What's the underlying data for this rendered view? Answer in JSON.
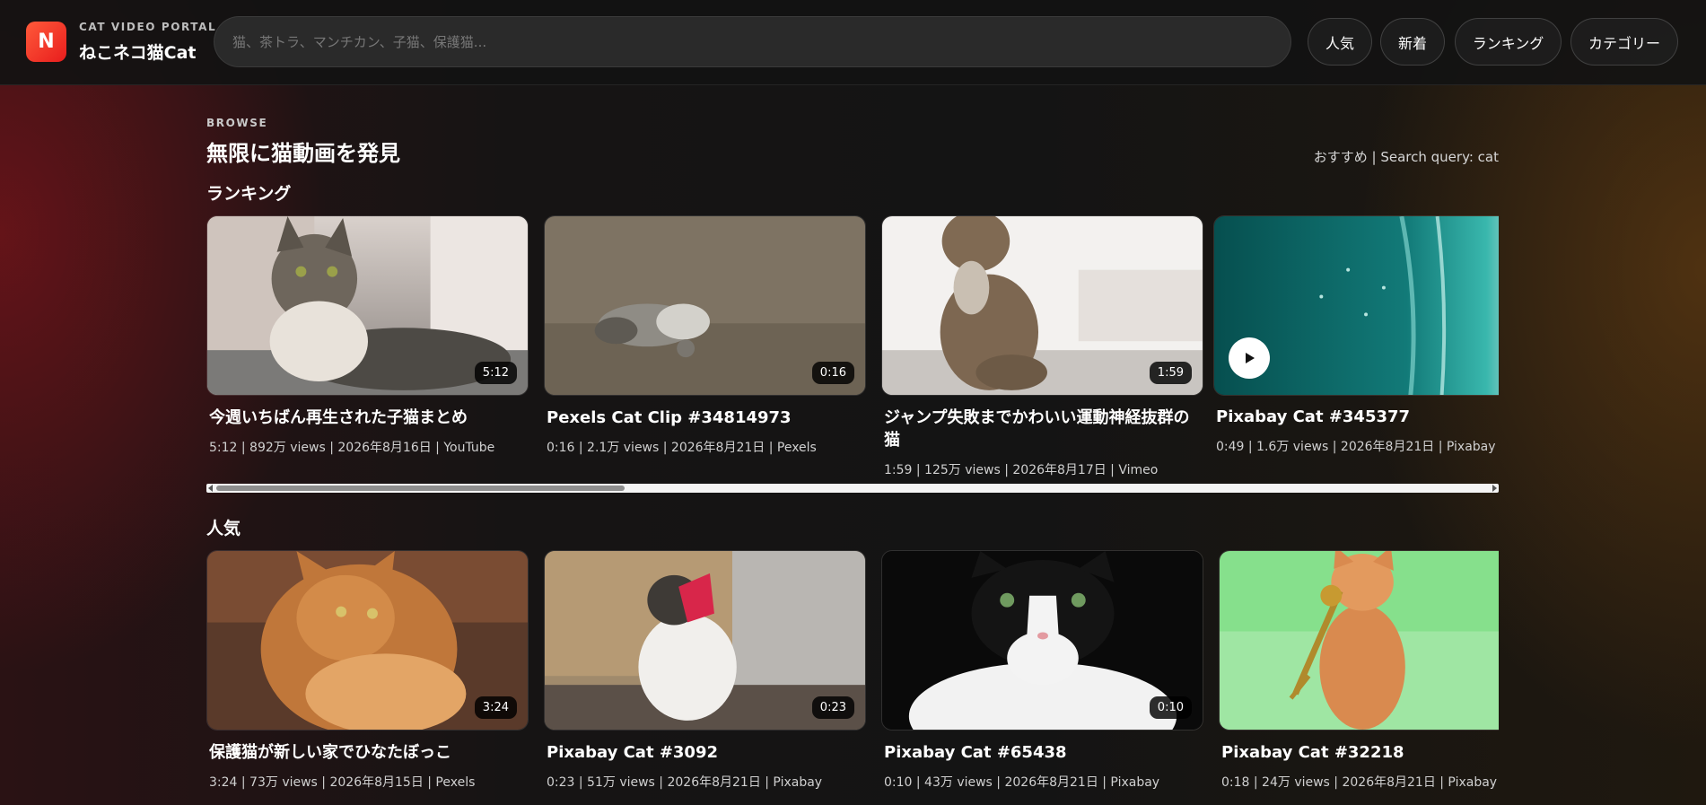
{
  "brand": {
    "badge": "N",
    "subtitle": "CAT VIDEO PORTAL",
    "title": "ねこネコ猫Cat"
  },
  "search": {
    "placeholder": "猫、茶トラ、マンチカン、子猫、保護猫..."
  },
  "nav": [
    "人気",
    "新着",
    "ランキング",
    "カテゴリー"
  ],
  "page": {
    "eyebrow": "BROWSE",
    "title": "無限に猫動画を発見",
    "meta": "おすすめ | Search query: cat"
  },
  "sections": [
    {
      "title": "ランキング",
      "cards": [
        {
          "title": "今週いちばん再生された子猫まとめ",
          "duration": "5:12",
          "meta": "5:12 | 892万 views | 2026年8月16日 | YouTube",
          "art": "tabby-on-sofa"
        },
        {
          "title": "Pexels Cat Clip #34814973",
          "duration": "0:16",
          "meta": "0:16 | 2.1万 views | 2026年8月21日 | Pexels",
          "art": "cat-on-dirt"
        },
        {
          "title": "ジャンプ失敗までかわいい運動神経抜群の猫",
          "duration": "1:59",
          "meta": "1:59 | 125万 views | 2026年8月17日 | Vimeo",
          "art": "tabby-sitting-bright"
        },
        {
          "title": "Pixabay Cat #345377",
          "duration": "",
          "meta": "0:49 | 1.6万 views | 2026年8月21日 | Pixabay",
          "art": "aerial-ocean"
        }
      ]
    },
    {
      "title": "人気",
      "cards": [
        {
          "title": "保護猫が新しい家でひなたぼっこ",
          "duration": "3:24",
          "meta": "3:24 | 73万 views | 2026年8月15日 | Pexels",
          "art": "orange-cat"
        },
        {
          "title": "Pixabay Cat #3092",
          "duration": "0:23",
          "meta": "0:23 | 51万 views | 2026年8月21日 | Pixabay",
          "art": "white-cat-scarf"
        },
        {
          "title": "Pixabay Cat #65438",
          "duration": "0:10",
          "meta": "0:10 | 43万 views | 2026年8月21日 | Pixabay",
          "art": "black-white-cat"
        },
        {
          "title": "Pixabay Cat #32218",
          "duration": "0:18",
          "meta": "0:18 | 24万 views | 2026年8月21日 | Pixabay",
          "art": "cat-greenscreen"
        }
      ]
    }
  ],
  "colors": {
    "accent": "#e81d1d",
    "background": "#141414"
  }
}
